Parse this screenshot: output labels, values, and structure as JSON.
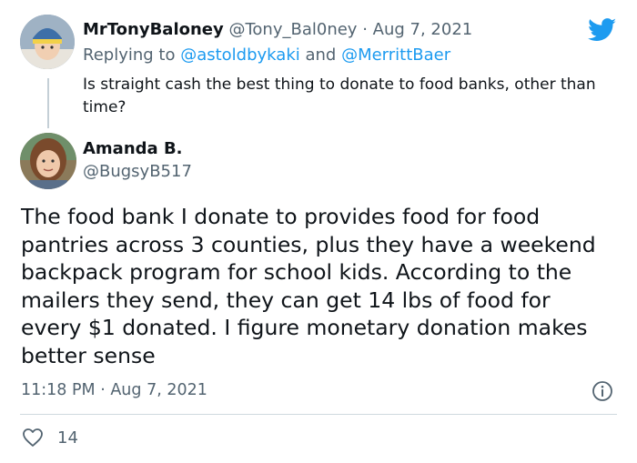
{
  "parent_tweet": {
    "display_name": "MrTonyBaloney",
    "handle": "@Tony_Bal0ney",
    "date": "· Aug 7, 2021",
    "replying_prefix": "Replying to ",
    "replying_to_1": "@astoldbykaki",
    "replying_and": " and ",
    "replying_to_2": "@MerrittBaer",
    "text": "Is straight cash the best thing to donate to food banks, other than time?"
  },
  "main_tweet": {
    "display_name": "Amanda B.",
    "handle": "@BugsyB517",
    "text": "The food bank I donate to provides food for food pantries across 3 counties, plus they have a weekend backpack program for school kids. According to the mailers they send, they can get 14 lbs of food for every $1 donated.  I figure monetary donation makes better sense",
    "timestamp": "11:18 PM · Aug 7, 2021",
    "like_count": "14"
  },
  "icons": {
    "brand": "twitter-bird-icon",
    "info": "info-icon",
    "like": "heart-icon"
  },
  "colors": {
    "brand_blue": "#1d9bf0",
    "text": "#0f1419",
    "muted": "#536471"
  }
}
